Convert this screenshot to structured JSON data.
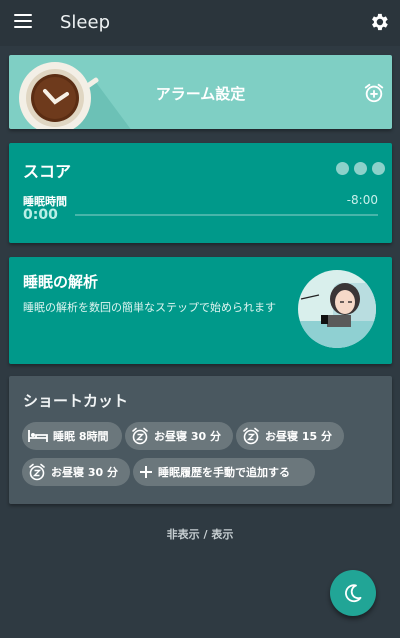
{
  "app": {
    "title": "Sleep"
  },
  "header": {
    "menu_icon": "hamburger-menu-icon",
    "settings_icon": "gear-icon"
  },
  "alarm_card": {
    "label": "アラーム設定",
    "add_icon": "add-alarm-icon",
    "image": "coffee-clock-illustration"
  },
  "score_card": {
    "title": "スコア",
    "sleep_time_label": "睡眠時間",
    "sleep_time_value": "0:00",
    "target": "-8:00",
    "progress": 0
  },
  "analysis_card": {
    "title": "睡眠の解析",
    "description": "睡眠の解析を数回の簡単なステップで始められます",
    "image": "sleeping-woman-illustration"
  },
  "shortcuts": {
    "title": "ショートカット",
    "chips": [
      {
        "label": "睡眠 8時間",
        "icon": "bed-icon"
      },
      {
        "label": "お昼寝 30 分",
        "icon": "nap-alarm-icon"
      },
      {
        "label": "お昼寝 15 分",
        "icon": "nap-alarm-icon"
      },
      {
        "label": "お昼寝 30 分",
        "icon": "nap-alarm-icon"
      },
      {
        "label": "睡眠履歴を手動で追加する",
        "icon": "plus-icon"
      }
    ]
  },
  "toggle_label": "非表示 / 表示",
  "fab": {
    "icon": "moon-icon"
  },
  "colors": {
    "accent": "#00998a",
    "alarm_card": "#7fcfc4",
    "background": "#2f3a42",
    "shortcut_card": "#4a5860",
    "chip": "#6b777c"
  }
}
